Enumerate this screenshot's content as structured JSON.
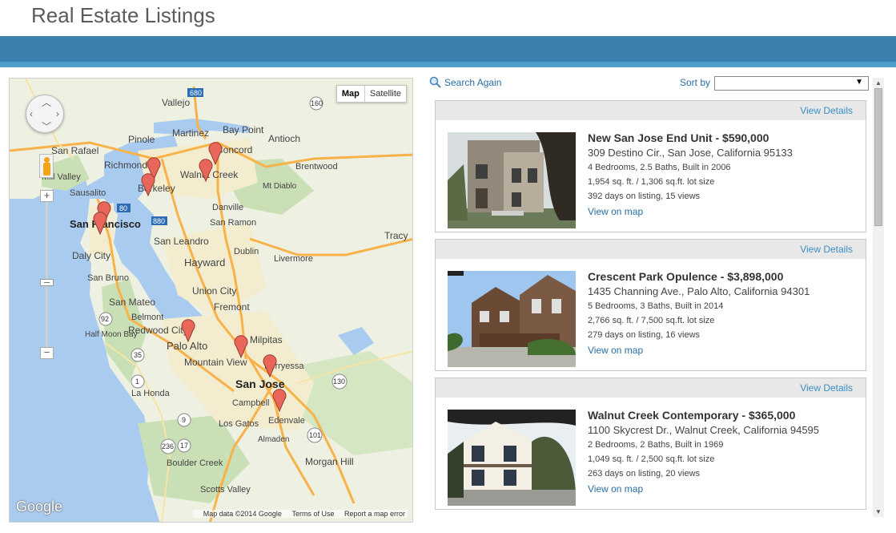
{
  "header": {
    "title": "Real Estate Listings"
  },
  "map": {
    "type_buttons": [
      "Map",
      "Satellite"
    ],
    "logo": "Google",
    "attribution": [
      "Map data ©2014 Google",
      "Terms of Use",
      "Report a map error"
    ],
    "places": [
      "Vallejo",
      "Martinez",
      "Pinole",
      "Concord",
      "Antioch",
      "Bay Point",
      "San Rafael",
      "Richmond",
      "Berkeley",
      "Walnut Creek",
      "Brentwood",
      "Mill Valley",
      "Sausalito",
      "Mt Diablo",
      "Danville",
      "San Francisco",
      "San Ramon",
      "Tracy",
      "Daly City",
      "San Leandro",
      "Dublin",
      "Livermore",
      "Hayward",
      "San Bruno",
      "Union City",
      "San Mateo",
      "Fremont",
      "Belmont",
      "Half Moon Bay",
      "Redwood City",
      "Palo Alto",
      "Milpitas",
      "Mountain View",
      "Berryessa",
      "San Jose",
      "La Honda",
      "Campbell",
      "Los Gatos",
      "Edenvale",
      "Almaden",
      "Boulder Creek",
      "Morgan Hill",
      "Scotts Valley"
    ],
    "highways": [
      "680",
      "160",
      "80",
      "880",
      "35",
      "1",
      "92",
      "130",
      "17",
      "9",
      "236",
      "101"
    ]
  },
  "controls": {
    "search_again": "Search Again",
    "sort_by_label": "Sort by",
    "sort_value": ""
  },
  "listings": [
    {
      "view_details": "View Details",
      "title": "New San Jose End Unit - $590,000",
      "address": "309 Destino Cir., San Jose, California 95133",
      "beds_baths": "4 Bedrooms, 2.5 Baths, Built in 2006",
      "size": "1,954 sq. ft. / 1,306 sq.ft. lot size",
      "stats": "392 days on listing, 15 views",
      "map_link": "View on map"
    },
    {
      "view_details": "View Details",
      "title": "Crescent Park Opulence - $3,898,000",
      "address": "1435 Channing Ave., Palo Alto, California 94301",
      "beds_baths": "5 Bedrooms, 3 Baths, Built in 2014",
      "size": "2,766 sq. ft. / 7,500 sq.ft. lot size",
      "stats": "279 days on listing, 16 views",
      "map_link": "View on map"
    },
    {
      "view_details": "View Details",
      "title": "Walnut Creek Contemporary - $365,000",
      "address": "1100 Skycrest Dr., Walnut Creek, California 94595",
      "beds_baths": "2 Bedrooms, 2 Baths, Built in 1969",
      "size": "1,049 sq. ft. / 2,500 sq.ft. lot size",
      "stats": "263 days on listing, 20 views",
      "map_link": "View on map"
    }
  ],
  "colors": {
    "band": "#3b80ae",
    "link": "#2a6fa4",
    "pin": "#e8675a"
  }
}
